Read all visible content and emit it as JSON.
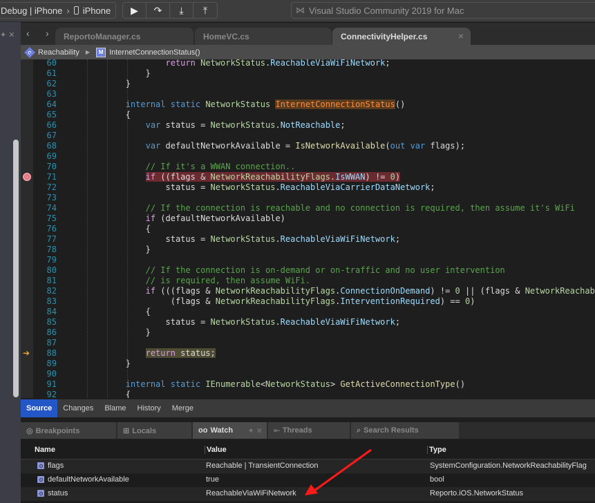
{
  "toolbar": {
    "scheme": "Debug | iPhone",
    "separator": "›",
    "device": "iPhone",
    "buttons": [
      "▶",
      "↷",
      "⤓",
      "⤒"
    ],
    "status_text": "Visual Studio Community 2019 for Mac"
  },
  "tabs": [
    {
      "label": "ReportoManager.cs",
      "active": false
    },
    {
      "label": "HomeVC.cs",
      "active": false
    },
    {
      "label": "ConnectivityHelper.cs",
      "active": true
    }
  ],
  "breadcrumb": {
    "class_name": "Reachability",
    "class_icon": "C",
    "method_name": "InternetConnectionStatus()",
    "method_icon": "M"
  },
  "editor": {
    "breakpoint_line": 71,
    "current_line": 88,
    "lines": [
      {
        "n": "60",
        "cls": "",
        "t": [
          [
            "",
            "                    "
          ],
          [
            "t-ctl",
            "return"
          ],
          [
            "",
            " "
          ],
          [
            "t-type",
            "NetworkStatus"
          ],
          [
            "",
            "."
          ],
          [
            "t-mem",
            "ReachableViaWiFiNetwork"
          ],
          [
            "",
            ";"
          ]
        ]
      },
      {
        "n": "61",
        "cls": "",
        "t": [
          [
            "",
            "                }"
          ]
        ]
      },
      {
        "n": "62",
        "cls": "",
        "t": [
          [
            "",
            "            }"
          ]
        ]
      },
      {
        "n": "63",
        "cls": "",
        "t": []
      },
      {
        "n": "64",
        "cls": "",
        "t": [
          [
            "",
            "            "
          ],
          [
            "t-kw",
            "internal"
          ],
          [
            "",
            " "
          ],
          [
            "t-kw",
            "static"
          ],
          [
            "",
            " "
          ],
          [
            "t-type",
            "NetworkStatus"
          ],
          [
            "",
            " "
          ],
          [
            "t-hlo",
            "InternetConnectionStatus"
          ],
          [
            "",
            "()"
          ]
        ]
      },
      {
        "n": "65",
        "cls": "",
        "t": [
          [
            "",
            "            {"
          ]
        ]
      },
      {
        "n": "66",
        "cls": "",
        "t": [
          [
            "",
            "                "
          ],
          [
            "t-kw",
            "var"
          ],
          [
            "",
            " status = "
          ],
          [
            "t-type",
            "NetworkStatus"
          ],
          [
            "",
            "."
          ],
          [
            "t-mem",
            "NotReachable"
          ],
          [
            "",
            ";"
          ]
        ]
      },
      {
        "n": "67",
        "cls": "",
        "t": []
      },
      {
        "n": "68",
        "cls": "",
        "t": [
          [
            "",
            "                "
          ],
          [
            "t-kw",
            "var"
          ],
          [
            "",
            " defaultNetworkAvailable = "
          ],
          [
            "t-meth",
            "IsNetworkAvailable"
          ],
          [
            "",
            "("
          ],
          [
            "t-kw",
            "out"
          ],
          [
            "",
            " "
          ],
          [
            "t-kw",
            "var"
          ],
          [
            "",
            " flags);"
          ]
        ]
      },
      {
        "n": "69",
        "cls": "",
        "t": []
      },
      {
        "n": "70",
        "cls": "",
        "t": [
          [
            "",
            "                "
          ],
          [
            "t-com",
            "// If it's a WWAN connection.."
          ]
        ]
      },
      {
        "n": "71",
        "cls": "bp",
        "t": [
          [
            "",
            "                "
          ],
          [
            "t-ctl bp-hl",
            "if"
          ],
          [
            "bp-hl",
            " ((flags & "
          ],
          [
            "t-type bp-hl",
            "NetworkReachabilityFlags"
          ],
          [
            "bp-hl",
            "."
          ],
          [
            "t-mem bp-hl",
            "IsWWAN"
          ],
          [
            "bp-hl",
            ") != "
          ],
          [
            "t-num bp-hl",
            "0"
          ],
          [
            "bp-hl",
            ")"
          ]
        ]
      },
      {
        "n": "72",
        "cls": "",
        "t": [
          [
            "",
            "                    status = "
          ],
          [
            "t-type",
            "NetworkStatus"
          ],
          [
            "",
            "."
          ],
          [
            "t-mem",
            "ReachableViaCarrierDataNetwork"
          ],
          [
            "",
            ";"
          ]
        ]
      },
      {
        "n": "73",
        "cls": "",
        "t": []
      },
      {
        "n": "74",
        "cls": "",
        "t": [
          [
            "",
            "                "
          ],
          [
            "t-com",
            "// If the connection is reachable and no connection is required, then assume it's WiFi"
          ]
        ]
      },
      {
        "n": "75",
        "cls": "",
        "t": [
          [
            "",
            "                "
          ],
          [
            "t-ctl",
            "if"
          ],
          [
            "",
            " (defaultNetworkAvailable)"
          ]
        ]
      },
      {
        "n": "76",
        "cls": "",
        "t": [
          [
            "",
            "                {"
          ]
        ]
      },
      {
        "n": "77",
        "cls": "",
        "t": [
          [
            "",
            "                    status = "
          ],
          [
            "t-type",
            "NetworkStatus"
          ],
          [
            "",
            "."
          ],
          [
            "t-mem",
            "ReachableViaWiFiNetwork"
          ],
          [
            "",
            ";"
          ]
        ]
      },
      {
        "n": "78",
        "cls": "",
        "t": [
          [
            "",
            "                }"
          ]
        ]
      },
      {
        "n": "79",
        "cls": "",
        "t": []
      },
      {
        "n": "80",
        "cls": "",
        "t": [
          [
            "",
            "                "
          ],
          [
            "t-com",
            "// If the connection is on-demand or on-traffic and no user intervention"
          ]
        ]
      },
      {
        "n": "81",
        "cls": "",
        "t": [
          [
            "",
            "                "
          ],
          [
            "t-com",
            "// is required, then assume WiFi."
          ]
        ]
      },
      {
        "n": "82",
        "cls": "",
        "t": [
          [
            "",
            "                "
          ],
          [
            "t-ctl",
            "if"
          ],
          [
            "",
            " (((flags & "
          ],
          [
            "t-type",
            "NetworkReachabilityFlags"
          ],
          [
            "",
            "."
          ],
          [
            "t-mem",
            "ConnectionOnDemand"
          ],
          [
            "",
            ") != "
          ],
          [
            "t-num",
            "0"
          ],
          [
            "",
            " || (flags & "
          ],
          [
            "t-type",
            "NetworkReachab"
          ]
        ]
      },
      {
        "n": "83",
        "cls": "",
        "t": [
          [
            "",
            "                     (flags & "
          ],
          [
            "t-type",
            "NetworkReachabilityFlags"
          ],
          [
            "",
            "."
          ],
          [
            "t-mem",
            "InterventionRequired"
          ],
          [
            "",
            ") == "
          ],
          [
            "t-num",
            "0"
          ],
          [
            "",
            ")"
          ]
        ]
      },
      {
        "n": "84",
        "cls": "",
        "t": [
          [
            "",
            "                {"
          ]
        ]
      },
      {
        "n": "85",
        "cls": "",
        "t": [
          [
            "",
            "                    status = "
          ],
          [
            "t-type",
            "NetworkStatus"
          ],
          [
            "",
            "."
          ],
          [
            "t-mem",
            "ReachableViaWiFiNetwork"
          ],
          [
            "",
            ";"
          ]
        ]
      },
      {
        "n": "86",
        "cls": "",
        "t": [
          [
            "",
            "                }"
          ]
        ]
      },
      {
        "n": "87",
        "cls": "",
        "t": []
      },
      {
        "n": "88",
        "cls": "cur",
        "t": [
          [
            "",
            "                "
          ],
          [
            "t-ctl ret-hl",
            "return"
          ],
          [
            "ret-hl",
            " status;"
          ]
        ]
      },
      {
        "n": "89",
        "cls": "",
        "t": [
          [
            "",
            "            }"
          ]
        ]
      },
      {
        "n": "90",
        "cls": "",
        "t": []
      },
      {
        "n": "91",
        "cls": "",
        "t": [
          [
            "",
            "            "
          ],
          [
            "t-kw",
            "internal"
          ],
          [
            "",
            " "
          ],
          [
            "t-kw",
            "static"
          ],
          [
            "",
            " "
          ],
          [
            "t-type",
            "IEnumerable"
          ],
          [
            "",
            "<"
          ],
          [
            "t-type",
            "NetworkStatus"
          ],
          [
            "",
            "> "
          ],
          [
            "t-meth",
            "GetActiveConnectionType"
          ],
          [
            "",
            "()"
          ]
        ]
      },
      {
        "n": "92",
        "cls": "",
        "t": [
          [
            "",
            "            {"
          ]
        ]
      }
    ]
  },
  "source_tabs": [
    {
      "label": "Source",
      "active": true
    },
    {
      "label": "Changes",
      "active": false
    },
    {
      "label": "Blame",
      "active": false
    },
    {
      "label": "History",
      "active": false
    },
    {
      "label": "Merge",
      "active": false
    }
  ],
  "pads": [
    {
      "label": "Breakpoints",
      "icon": "◎",
      "active": false
    },
    {
      "label": "Locals",
      "icon": "⊞",
      "active": false
    },
    {
      "label": "Watch",
      "icon": "oo",
      "active": true
    },
    {
      "label": "Threads",
      "icon": "⟜",
      "active": false
    },
    {
      "label": "Search Results",
      "icon": "⌕",
      "active": false
    }
  ],
  "watch": {
    "columns": [
      "Name",
      "Value",
      "Type"
    ],
    "rows": [
      {
        "name": "flags",
        "value": "Reachable | TransientConnection",
        "type": "SystemConfiguration.NetworkReachabilityFlag"
      },
      {
        "name": "defaultNetworkAvailable",
        "value": "true",
        "type": "bool"
      },
      {
        "name": "status",
        "value": "ReachableViaWiFiNetwork",
        "type": "Reporto.iOS.NetworkStatus"
      }
    ]
  },
  "annotation_color": "#ff1a1a"
}
